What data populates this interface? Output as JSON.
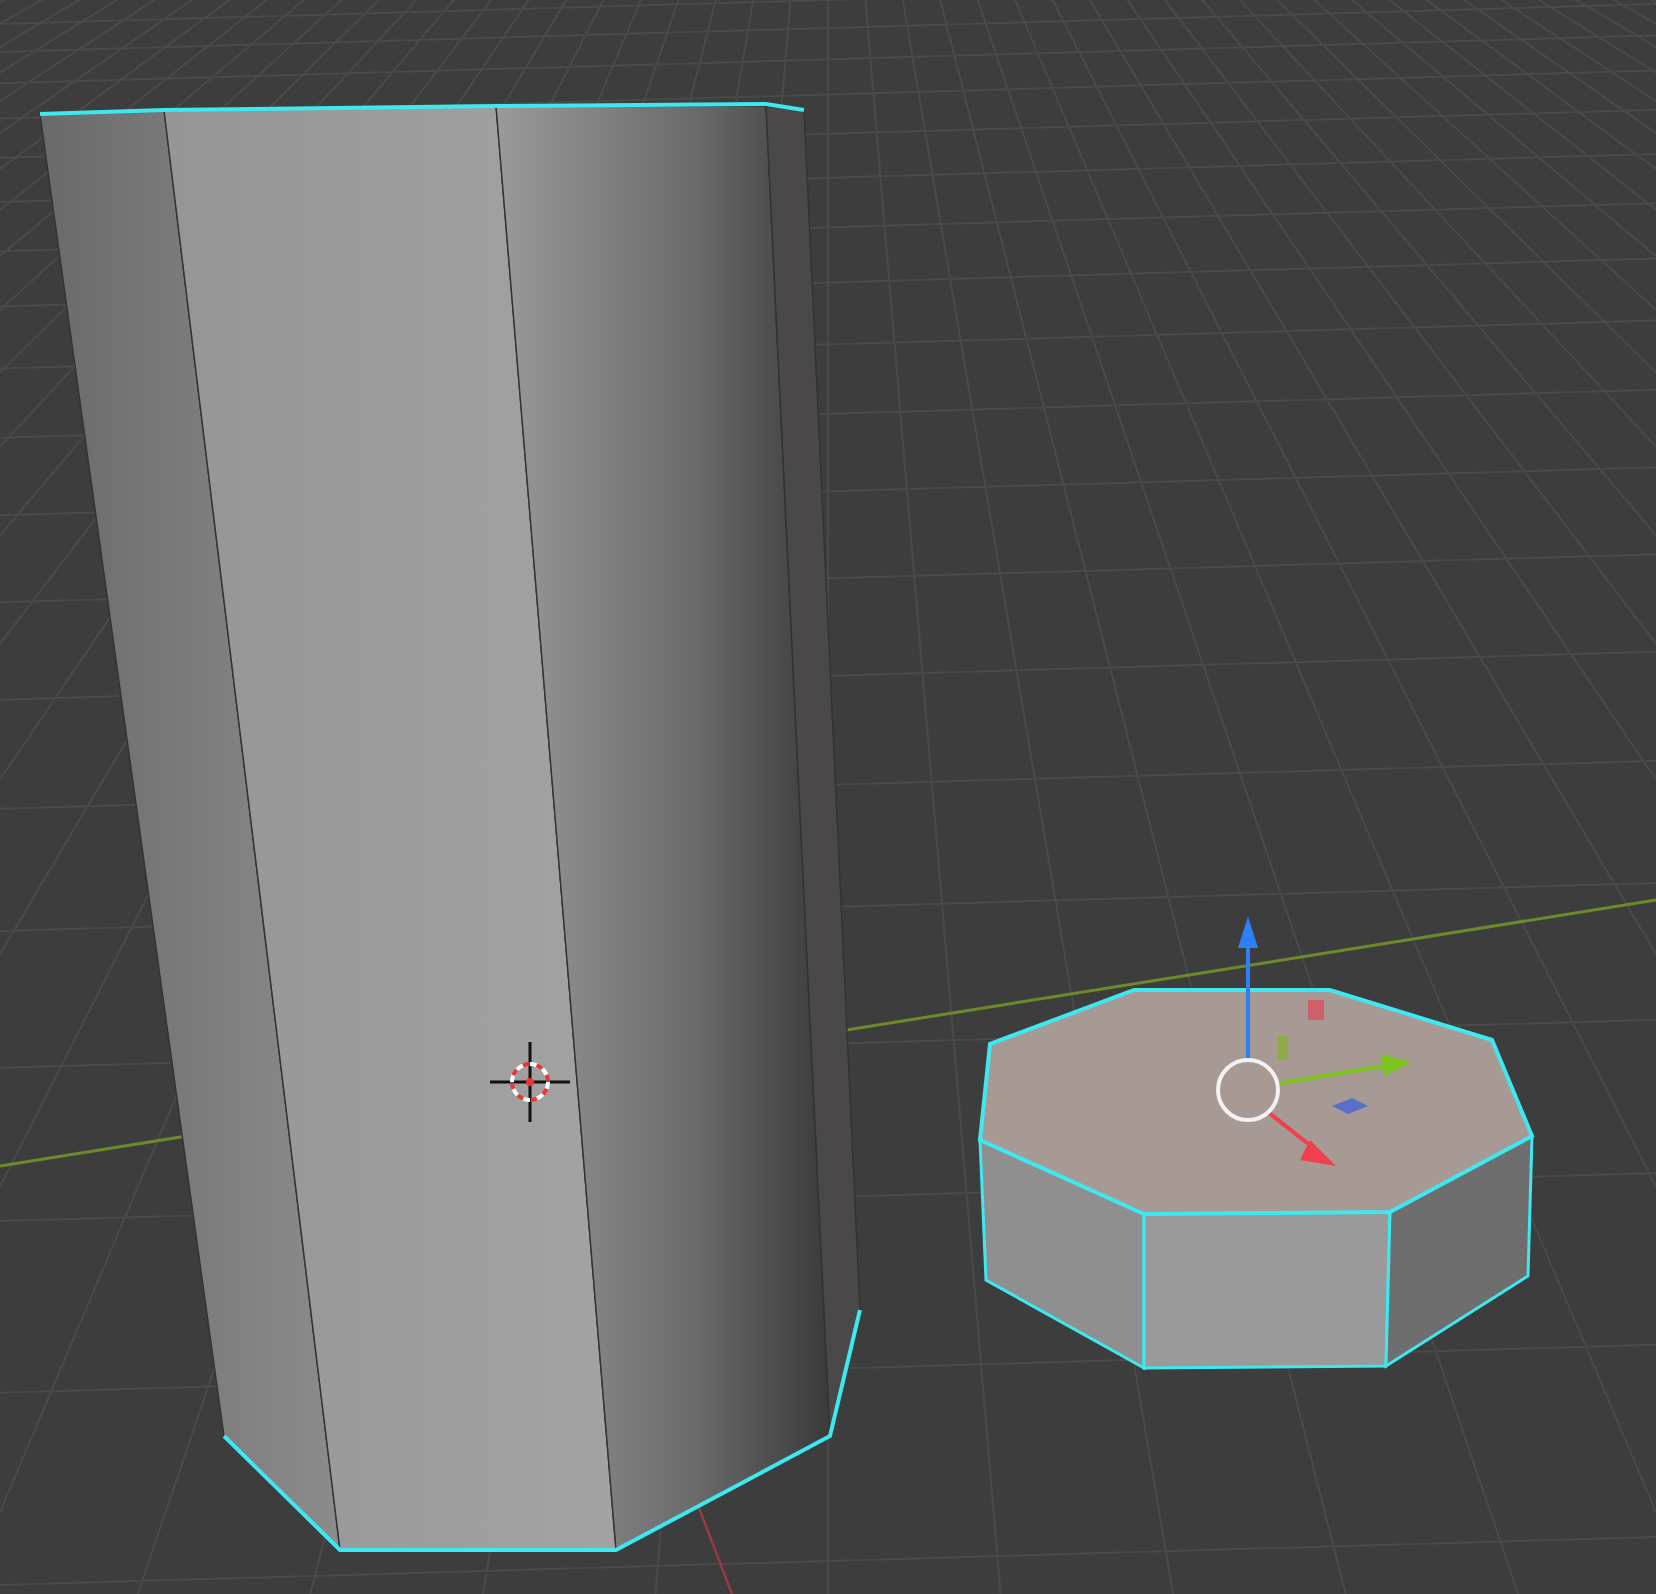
{
  "viewport": {
    "objects": [
      {
        "kind": "tall-prism",
        "selected": true
      },
      {
        "kind": "short-prism",
        "selected": true
      }
    ],
    "gizmo": {
      "shown": true
    },
    "cursor": {
      "shown": true
    }
  }
}
